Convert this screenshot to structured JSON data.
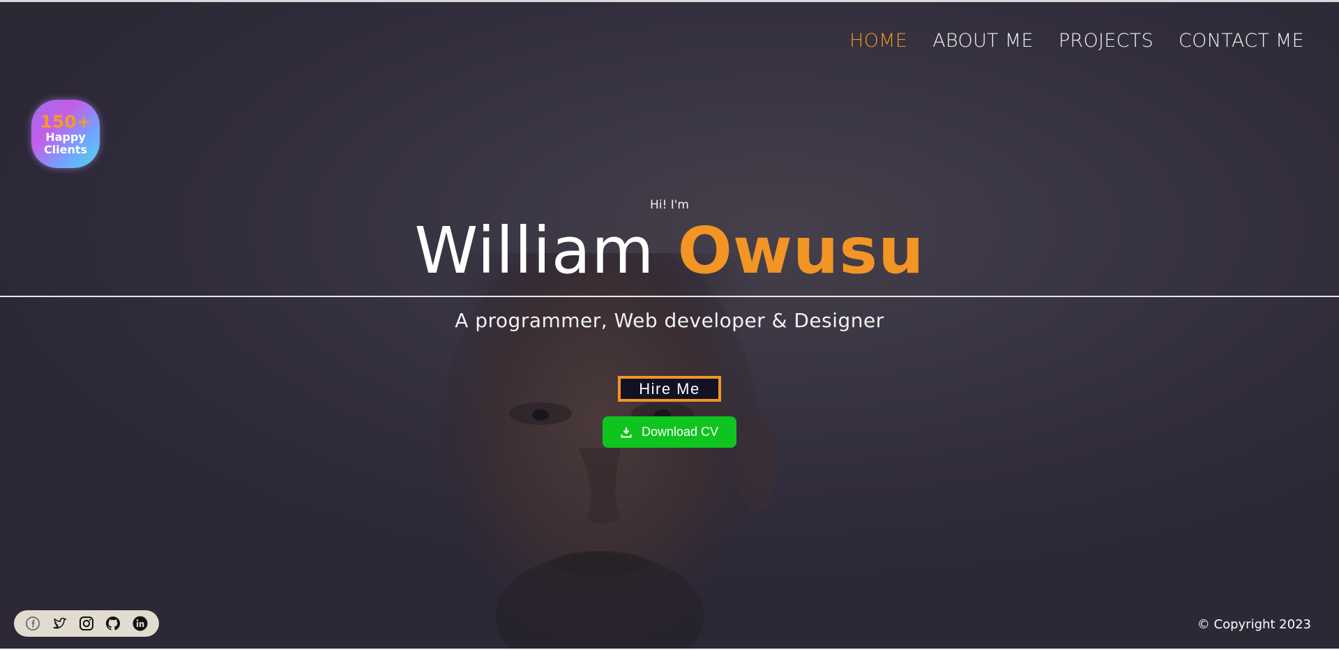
{
  "nav": {
    "items": [
      {
        "label": "HOME",
        "active": true
      },
      {
        "label": "ABOUT ME",
        "active": false
      },
      {
        "label": "PROJECTS",
        "active": false
      },
      {
        "label": "CONTACT ME",
        "active": false
      }
    ]
  },
  "badge": {
    "count": "150+",
    "line1": "Happy",
    "line2": "Clients"
  },
  "hero": {
    "greeting": "Hi! I'm",
    "first_name": "William",
    "last_name": "Owusu",
    "tagline": "A programmer, Web developer & Designer",
    "hire_label": "Hire Me",
    "cv_label": "Download CV"
  },
  "social": {
    "icons": [
      "facebook-icon",
      "twitter-icon",
      "instagram-icon",
      "github-icon",
      "linkedin-icon"
    ]
  },
  "footer": {
    "copyright": "© Copyright 2023"
  },
  "colors": {
    "accent": "#f29525",
    "cv_button": "#0fc41f",
    "hire_bg": "#111225",
    "social_bar": "#e2dbd0"
  }
}
